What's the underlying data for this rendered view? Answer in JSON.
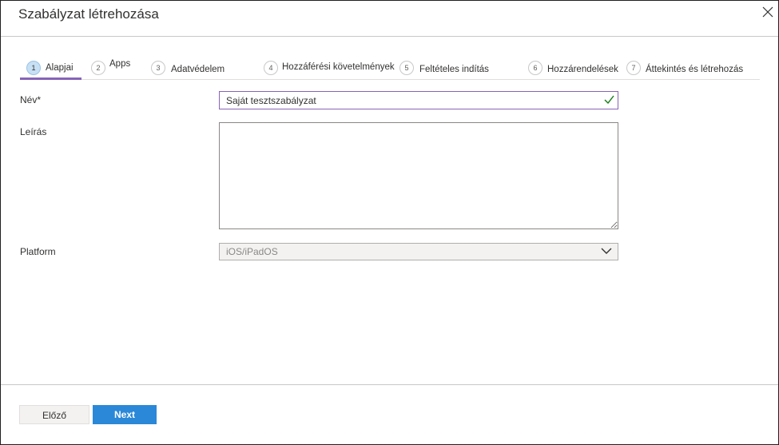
{
  "dialog": {
    "title": "Szabályzat létrehozása",
    "close_icon": "close-icon"
  },
  "steps": [
    {
      "number": "1",
      "label": "Alapjai",
      "active": true
    },
    {
      "number": "2",
      "label": "Apps",
      "active": false
    },
    {
      "number": "3",
      "label": "Adatvédelem",
      "active": false
    },
    {
      "number": "4",
      "label": "Hozzáférési követelmények",
      "active": false
    },
    {
      "number": "5",
      "label": "Feltételes indítás",
      "active": false
    },
    {
      "number": "6",
      "label": "Hozzárendelések",
      "active": false
    },
    {
      "number": "7",
      "label": "Áttekintés és létrehozás",
      "active": false
    }
  ],
  "form": {
    "name_label": "Név*",
    "name_value": "Saját tesztszabályzat",
    "name_valid_icon": "checkmark-icon",
    "description_label": "Leírás",
    "description_value": "",
    "platform_label": "Platform",
    "platform_value": "iOS/iPadOS",
    "platform_dropdown_icon": "chevron-down-icon"
  },
  "footer": {
    "prev_label": "Előző",
    "next_label": "Next"
  },
  "colors": {
    "accent": "#8764b8",
    "primary_button": "#2b88d8",
    "valid_check": "#107c10",
    "active_step_circle": "#c7e0f4"
  }
}
